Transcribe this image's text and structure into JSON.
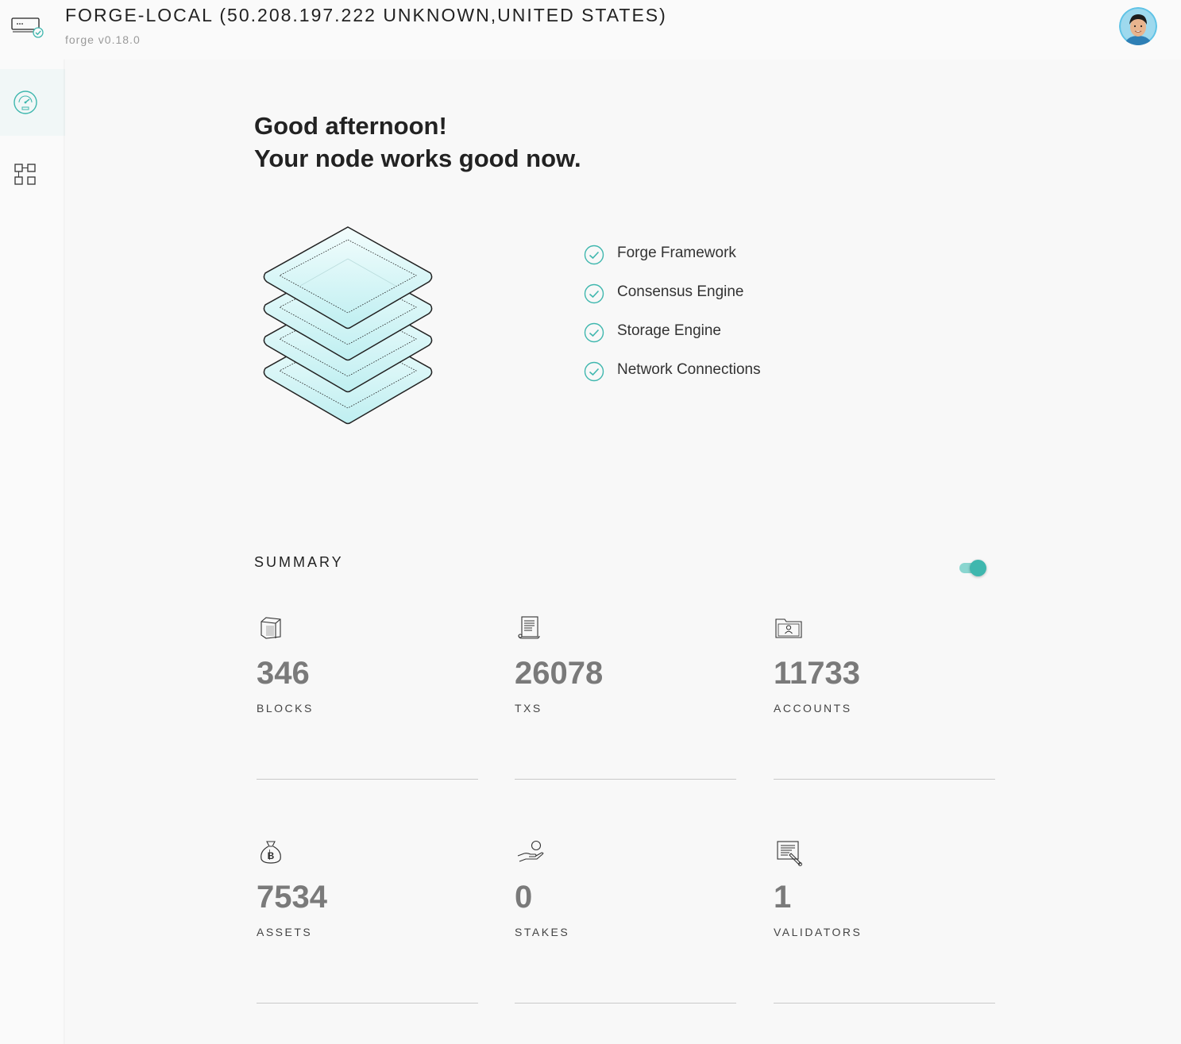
{
  "header": {
    "title": "FORGE-LOCAL (50.208.197.222 UNKNOWN,UNITED STATES)",
    "subtitle": "forge v0.18.0"
  },
  "sidebar": {
    "items": [
      {
        "name": "dashboard",
        "icon": "speedometer-icon",
        "active": true
      },
      {
        "name": "apps",
        "icon": "grid-icon",
        "active": false
      }
    ]
  },
  "greeting": {
    "line1": "Good afternoon!",
    "line2": "Your node works good now."
  },
  "checks": [
    {
      "label": "Forge Framework",
      "status": "ok"
    },
    {
      "label": "Consensus Engine",
      "status": "ok"
    },
    {
      "label": "Storage Engine",
      "status": "ok"
    },
    {
      "label": "Network Connections",
      "status": "ok"
    }
  ],
  "summary": {
    "title": "SUMMARY",
    "toggle_on": true,
    "stats": [
      {
        "value": "346",
        "label": "BLOCKS",
        "icon": "block-cube-icon"
      },
      {
        "value": "26078",
        "label": "TXS",
        "icon": "receipt-scroll-icon"
      },
      {
        "value": "11733",
        "label": "ACCOUNTS",
        "icon": "account-folder-icon"
      },
      {
        "value": "7534",
        "label": "ASSETS",
        "icon": "money-bag-icon"
      },
      {
        "value": "0",
        "label": "STAKES",
        "icon": "hand-coin-icon"
      },
      {
        "value": "1",
        "label": "VALIDATORS",
        "icon": "validator-document-icon"
      }
    ]
  },
  "colors": {
    "accent": "#3fb7ae",
    "accent_light": "#8ad6d0",
    "value_gray": "#7a7a7a"
  }
}
